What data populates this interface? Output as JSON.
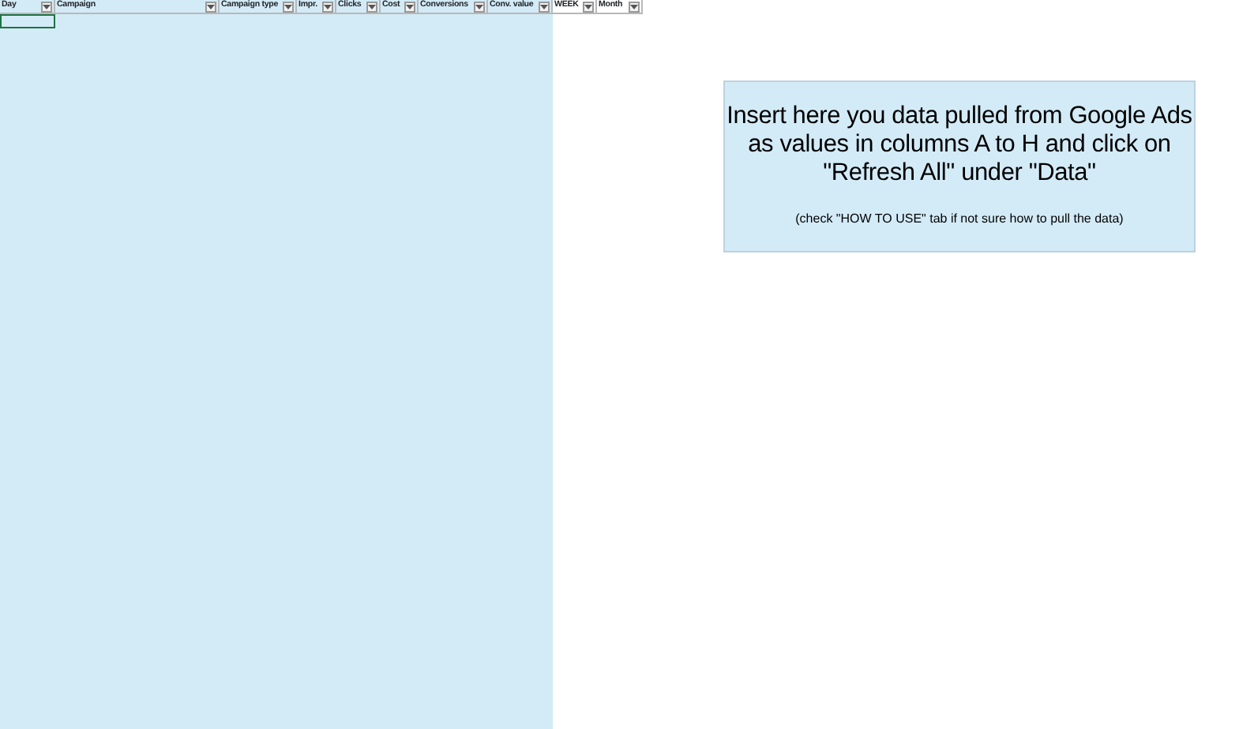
{
  "columns": [
    {
      "label": "Day",
      "tinted": true
    },
    {
      "label": "Campaign",
      "tinted": true
    },
    {
      "label": "Campaign type",
      "tinted": true
    },
    {
      "label": "Impr.",
      "tinted": true
    },
    {
      "label": "Clicks",
      "tinted": true
    },
    {
      "label": "Cost",
      "tinted": true
    },
    {
      "label": "Conversions",
      "tinted": true
    },
    {
      "label": "Conv. value",
      "tinted": true
    },
    {
      "label": "WEEK",
      "tinted": false
    },
    {
      "label": "Month",
      "tinted": false
    }
  ],
  "note": {
    "heading": "Insert here you data pulled from Google Ads as values in columns A to H and click on \"Refresh All\" under \"Data\"",
    "hint": "(check \"HOW TO USE\" tab if not sure how to pull the data)"
  }
}
